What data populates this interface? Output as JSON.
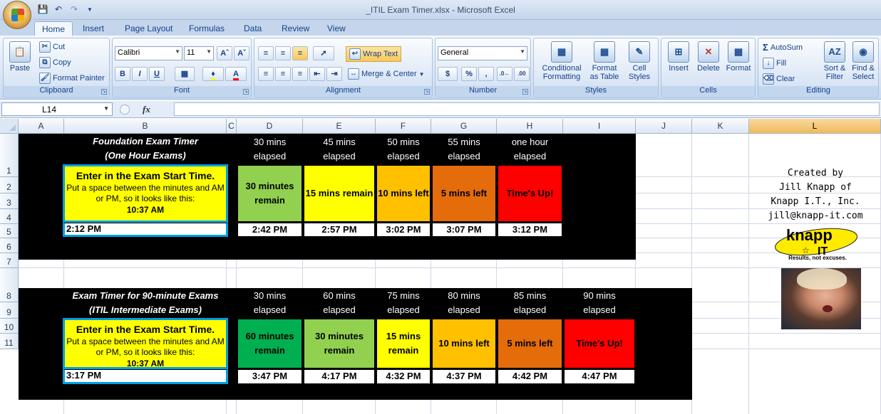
{
  "window": {
    "title": "_ITIL Exam Timer.xlsx - Microsoft Excel"
  },
  "ribbon_tabs": [
    "Home",
    "Insert",
    "Page Layout",
    "Formulas",
    "Data",
    "Review",
    "View"
  ],
  "clipboard": {
    "paste": "Paste",
    "cut": "Cut",
    "copy": "Copy",
    "format_painter": "Format Painter",
    "label": "Clipboard"
  },
  "font": {
    "name": "Calibri",
    "size": "11",
    "label": "Font",
    "bold": "B",
    "italic": "I",
    "underline": "U"
  },
  "alignment": {
    "wrap_text": "Wrap Text",
    "merge_center": "Merge & Center",
    "label": "Alignment"
  },
  "number": {
    "format": "General",
    "label": "Number",
    "currency": "$",
    "percent": "%",
    "comma": ","
  },
  "styles": {
    "conditional": "Conditional",
    "conditional2": "Formatting",
    "format_as": "Format",
    "format_as2": "as Table",
    "cell": "Cell",
    "cell2": "Styles",
    "label": "Styles"
  },
  "cells": {
    "insert": "Insert",
    "delete": "Delete",
    "format": "Format",
    "label": "Cells"
  },
  "editing": {
    "autosum": "AutoSum",
    "fill": "Fill",
    "clear": "Clear",
    "sort1": "Sort &",
    "sort2": "Filter",
    "find1": "Find &",
    "find2": "Select",
    "label": "Editing"
  },
  "formula_bar": {
    "name_box": "L14",
    "fx": "fx",
    "value": ""
  },
  "columns": [
    "A",
    "B",
    "C",
    "D",
    "E",
    "F",
    "G",
    "H",
    "I",
    "J",
    "K",
    "L"
  ],
  "rows": [
    "1",
    "2",
    "3",
    "4",
    "5",
    "6",
    "7",
    "8",
    "9",
    "10",
    "11"
  ],
  "timer1": {
    "title1": "Foundation Exam Timer",
    "title2": "(One Hour Exams)",
    "headers": [
      [
        "30 mins",
        "elapsed"
      ],
      [
        "45 mins",
        "elapsed"
      ],
      [
        "50 mins",
        "elapsed"
      ],
      [
        "55 mins",
        "elapsed"
      ],
      [
        "one hour",
        "elapsed"
      ]
    ],
    "status": [
      "30 minutes remain",
      "15 mins remain",
      "10 mins left",
      "5 mins left",
      "Time's Up!"
    ],
    "colors": [
      "#92d050",
      "#ffff00",
      "#ffc000",
      "#e46c0a",
      "#ff0000"
    ],
    "start": "2:12 PM",
    "times": [
      "2:42 PM",
      "2:57 PM",
      "3:02 PM",
      "3:07 PM",
      "3:12 PM"
    ]
  },
  "timer2": {
    "title1": "Exam Timer for 90-minute Exams",
    "title2": "(ITIL Intermediate Exams)",
    "headers": [
      [
        "30 mins",
        "elapsed"
      ],
      [
        "60 mins",
        "elapsed"
      ],
      [
        "75 mins",
        "elapsed"
      ],
      [
        "80 mins",
        "elapsed"
      ],
      [
        "85 mins",
        "elapsed"
      ],
      [
        "90 mins",
        "elapsed"
      ]
    ],
    "status": [
      "60 minutes remain",
      "30 minutes remain",
      "15 mins remain",
      "10 mins left",
      "5 mins left",
      "Time's Up!"
    ],
    "colors": [
      "#00b050",
      "#92d050",
      "#ffff00",
      "#ffc000",
      "#e46c0a",
      "#ff0000"
    ],
    "start": "3:17 PM",
    "times": [
      "3:47 PM",
      "4:17 PM",
      "4:32 PM",
      "4:37 PM",
      "4:42 PM",
      "4:47 PM"
    ]
  },
  "instructions": {
    "heading": "Enter in the Exam Start Time.",
    "body": "Put a space between the minutes and AM or PM, so it looks like this:",
    "example": "10:37 AM"
  },
  "credit": {
    "line1": "Created by",
    "line2": "Jill Knapp of",
    "line3": "Knapp I.T., Inc.",
    "line4": "jill@knapp-it.com"
  },
  "logo": {
    "text1": "knapp",
    "text2": "IT",
    "tagline": "Results, not excuses."
  }
}
